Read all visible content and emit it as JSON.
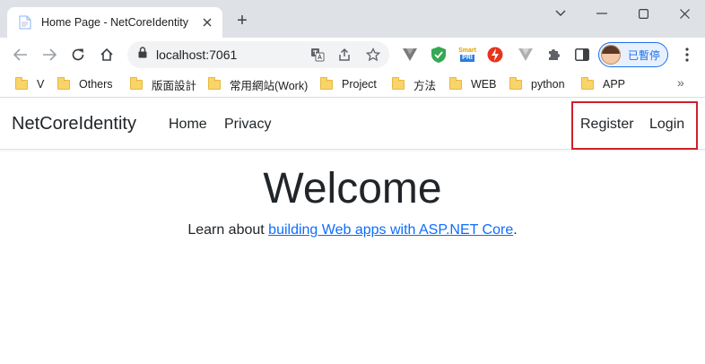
{
  "browser": {
    "tab": {
      "title": "Home Page - NetCoreIdentity",
      "favicon": "document-icon"
    },
    "new_tab_label": "+",
    "address_bar": {
      "url": "localhost:7061"
    },
    "profile": {
      "label": "已暫停"
    },
    "bookmarks": [
      "V",
      "Others",
      "版面設計",
      "常用網站(Work)",
      "Project",
      "方法",
      "WEB",
      "python",
      "APP"
    ],
    "bookmarks_overflow": "»",
    "extensions": {
      "smart_label_top": "Smart",
      "smart_label_bottom": "PRI"
    }
  },
  "site": {
    "brand": "NetCoreIdentity",
    "nav": {
      "home": "Home",
      "privacy": "Privacy",
      "register": "Register",
      "login": "Login"
    },
    "welcome": "Welcome",
    "lead_prefix": "Learn about ",
    "lead_link": "building Web apps with ASP.NET Core",
    "lead_suffix": "."
  },
  "colors": {
    "tabstrip_bg": "#dee1e6",
    "link": "#0d6efd",
    "highlight_border": "#d0202a",
    "profile_accent": "#1a73e8"
  }
}
